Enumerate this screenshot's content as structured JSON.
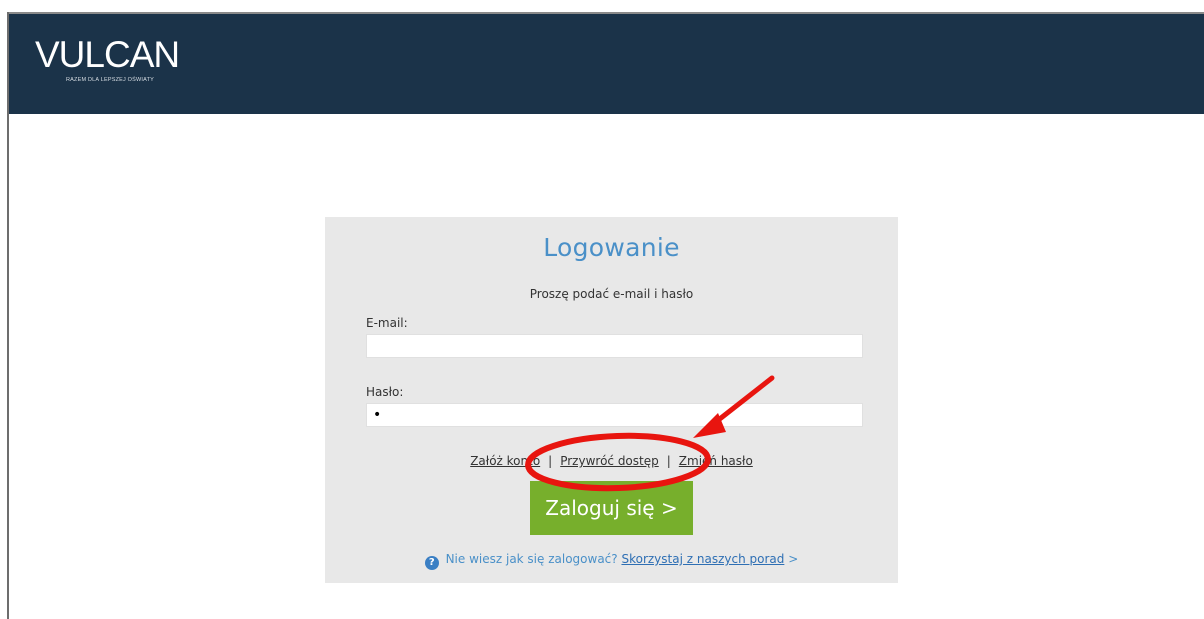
{
  "header": {
    "logo_text": "VULCAN",
    "logo_tagline": "RAZEM DLA LEPSZEJ OŚWIATY"
  },
  "login": {
    "title": "Logowanie",
    "subtitle": "Proszę podać e-mail i hasło",
    "email_label": "E-mail:",
    "email_value": "",
    "password_label": "Hasło:",
    "password_value": "•",
    "links": {
      "create_account": "Załóż konto",
      "restore_access": "Przywróć dostęp",
      "change_password": "Zmień hasło",
      "separator": "|"
    },
    "submit_label": "Zaloguj się >",
    "help_text": "Nie wiesz jak się zalogować?",
    "help_link": "Skorzystaj z naszych porad",
    "help_arrow": ">",
    "help_icon": "question-circle-icon"
  },
  "colors": {
    "header_bg": "#1b3349",
    "panel_bg": "#e8e8e8",
    "accent_blue": "#4a90c8",
    "button_green": "#77af2c",
    "annotation_red": "#e8150f"
  }
}
